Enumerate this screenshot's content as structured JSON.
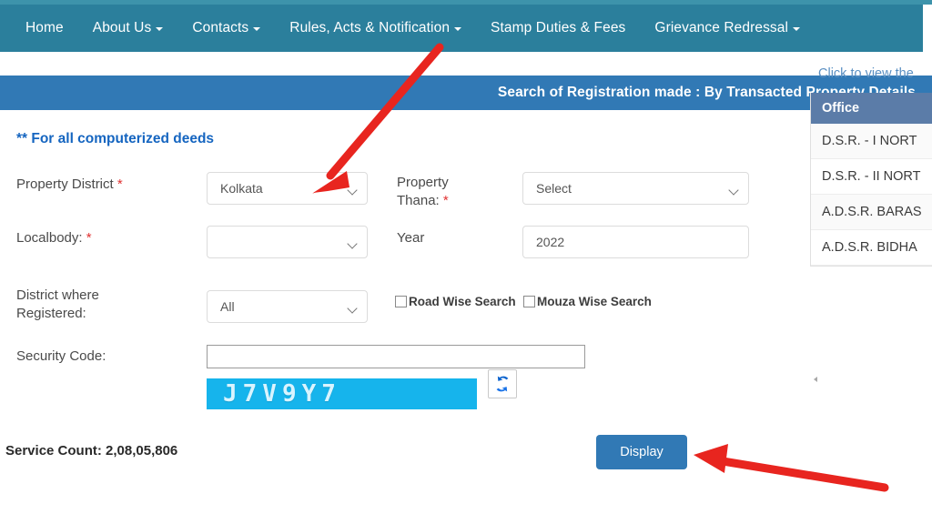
{
  "navbar": {
    "items": [
      {
        "label": "Home",
        "caret": false
      },
      {
        "label": "About Us",
        "caret": true
      },
      {
        "label": "Contacts",
        "caret": true
      },
      {
        "label": "Rules, Acts & Notification",
        "caret": true
      },
      {
        "label": "Stamp Duties & Fees",
        "caret": false
      },
      {
        "label": "Grievance Redressal",
        "caret": true
      }
    ]
  },
  "banner": {
    "title": "Search of Registration made : By Transacted Property Details",
    "bg_color": "#3179b5"
  },
  "form": {
    "note": "** For all computerized deeds",
    "property_district": {
      "label": "Property District",
      "required_marker": "*",
      "value": "Kolkata"
    },
    "property_thana": {
      "label": "Property Thana:",
      "required_marker": "*",
      "value": "Select"
    },
    "localbody": {
      "label": "Localbody:",
      "required_marker": "*",
      "value": ""
    },
    "year": {
      "label": "Year",
      "value": "2022"
    },
    "district_registered": {
      "label_line1": "District where",
      "label_line2": "Registered:",
      "value": "All"
    },
    "road_wise_search": {
      "label": "Road Wise Search",
      "checked": false
    },
    "mouza_wise_search": {
      "label": "Mouza Wise Search",
      "checked": false
    },
    "security_code": {
      "label": "Security Code:",
      "value": "",
      "captcha_text": "J7V9Y7",
      "captcha_bg": "#16b4ec",
      "refresh_icon": "refresh-icon"
    },
    "service_count": "Service Count: 2,08,05,806",
    "display_button": "Display"
  },
  "right_panel": {
    "link_text": "Click to view the",
    "table": {
      "header": "Office",
      "rows": [
        "D.S.R. - I NORT",
        "D.S.R. - II NORT",
        "A.D.S.R. BARAS",
        "A.D.S.R. BIDHA"
      ]
    }
  },
  "annotations": {
    "arrow_color": "#e8251f",
    "arrow_1_target": "property-district-select",
    "arrow_2_target": "display-button"
  }
}
